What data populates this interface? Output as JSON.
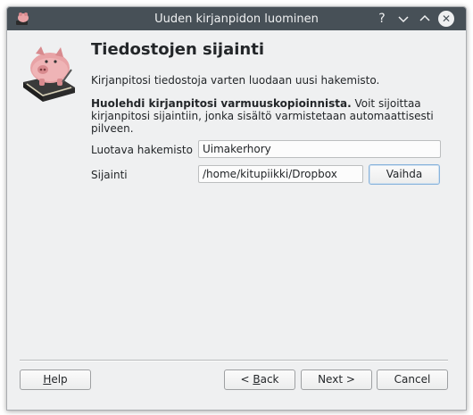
{
  "window": {
    "title": "Uuden kirjanpidon luominen",
    "buttons": {
      "help": "?",
      "minimize": "﹀",
      "maximize": "︿",
      "close": "✕"
    }
  },
  "page": {
    "title": "Tiedostojen sijainti",
    "intro": "Kirjanpitosi tiedostoja varten luodaan uusi hakemisto.",
    "backup_bold": "Huolehdi kirjanpitosi varmuuskopioinnista.",
    "backup_rest": " Voit sijoittaa kirjanpitosi sijaintiin, jonka sisältö varmistetaan automaattisesti pilveen."
  },
  "form": {
    "dir_label": "Luotava hakemisto",
    "dir_value": "Uimakerhory",
    "location_label": "Sijainti",
    "location_value": "/home/kitupiikki/Dropbox",
    "change_button": "Vaihda"
  },
  "footer": {
    "help_label": "elp",
    "help_mnemonic": "H",
    "back_prefix": "< ",
    "back_mnemonic": "B",
    "back_rest": "ack",
    "next_label": "Next >",
    "cancel_label": "Cancel"
  },
  "icons": {
    "app": "piggy-bank-icon",
    "page": "piggy-bank-book-icon"
  },
  "colors": {
    "titlebar": "#475057",
    "window_bg": "#eff0f1",
    "pig": "#e8a3a6"
  }
}
